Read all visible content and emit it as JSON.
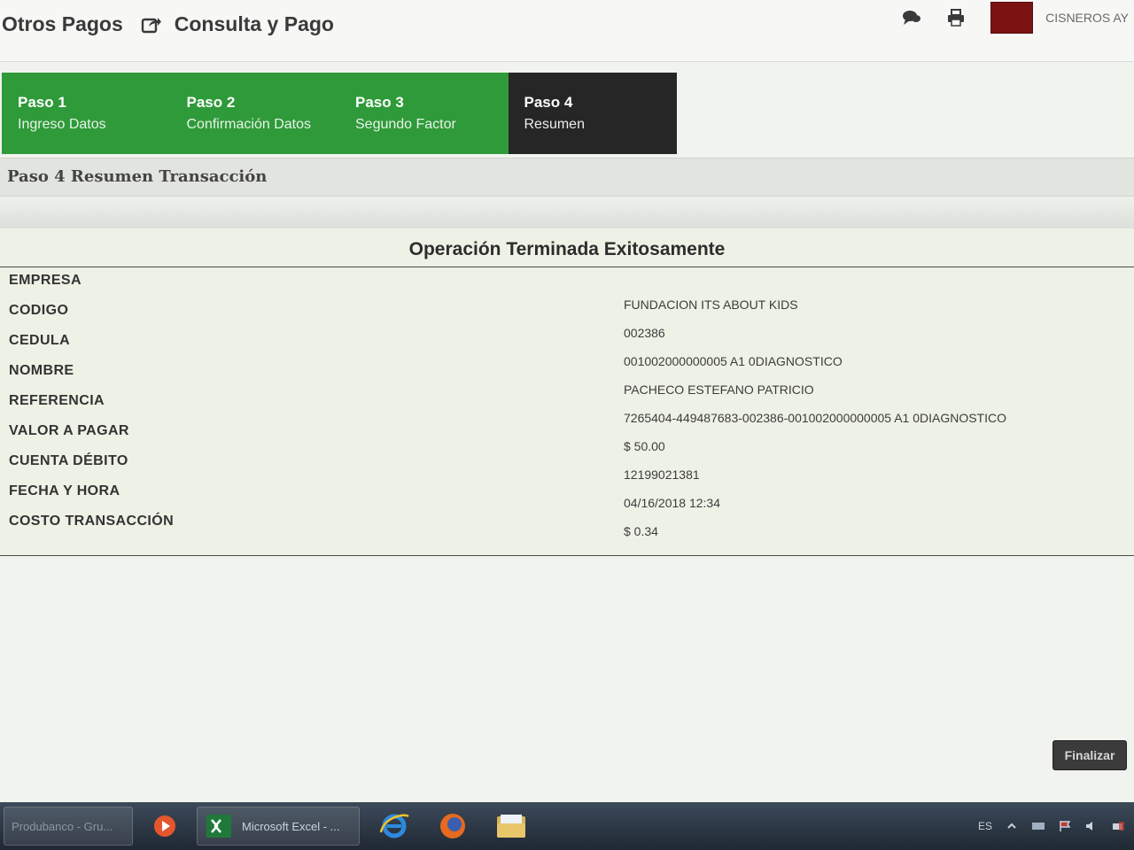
{
  "header": {
    "section": "Otros Pagos",
    "page": "Consulta y Pago",
    "user_name": "CISNEROS AY"
  },
  "wizard": {
    "steps": [
      {
        "num": "Paso 1",
        "name": "Ingreso Datos",
        "active": false
      },
      {
        "num": "Paso 2",
        "name": "Confirmación Datos",
        "active": false
      },
      {
        "num": "Paso 3",
        "name": "Segundo Factor",
        "active": false
      },
      {
        "num": "Paso 4",
        "name": "Resumen",
        "active": true
      }
    ]
  },
  "section_title": "Paso 4 Resumen Transacción",
  "result": {
    "title": "Operación Terminada Exitosamente",
    "labels": [
      "EMPRESA",
      "CODIGO",
      "CEDULA",
      "NOMBRE",
      "REFERENCIA",
      "VALOR A PAGAR",
      "CUENTA DÉBITO",
      "FECHA Y HORA",
      "COSTO TRANSACCIÓN"
    ],
    "values": [
      "FUNDACION ITS ABOUT KIDS",
      "002386",
      "001002000000005 A1 0DIAGNOSTICO",
      "PACHECO ESTEFANO PATRICIO",
      "7265404-449487683-002386-001002000000005 A1 0DIAGNOSTICO",
      "$ 50.00",
      "12199021381",
      "04/16/2018 12:34",
      "$ 0.34"
    ]
  },
  "actions": {
    "finalize_label": "Finalizar"
  },
  "taskbar": {
    "items": [
      "Produbanco - Gru...",
      "Microsoft Excel - ..."
    ],
    "tray_lang": "ES"
  },
  "colors": {
    "step_green": "#2f9a3a",
    "step_active": "#262626",
    "panel_bg": "#eef2e6"
  }
}
